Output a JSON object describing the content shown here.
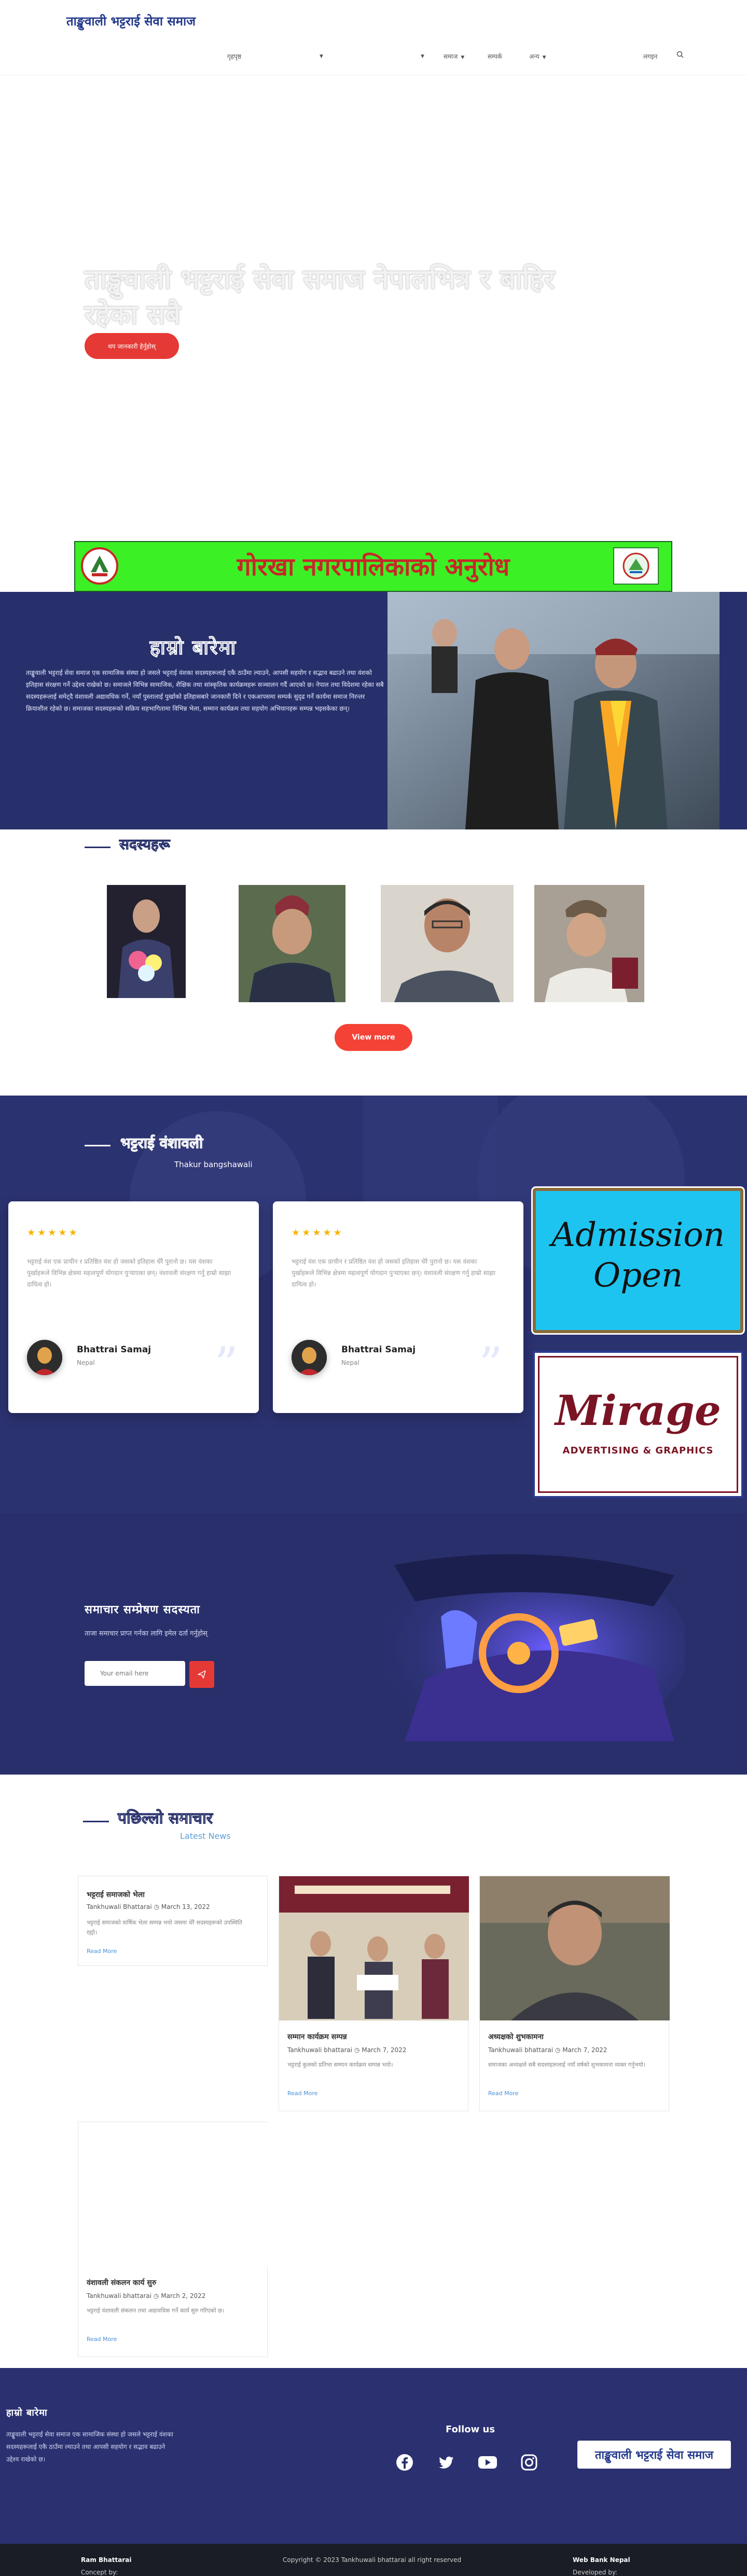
{
  "site": {
    "logo_text": "ताङ्खुवाली भट्टराई सेवा समाज"
  },
  "nav": {
    "items": [
      {
        "label": "गृहपृष्ठ",
        "dropdown": false
      },
      {
        "label": "",
        "dropdown": true
      },
      {
        "label": "",
        "dropdown": true
      },
      {
        "label": "समाज",
        "dropdown": true
      },
      {
        "label": "सम्पर्क",
        "dropdown": false
      },
      {
        "label": "अन्य",
        "dropdown": true
      },
      {
        "label": "लगइन",
        "dropdown": false
      }
    ],
    "search_icon": "search-icon"
  },
  "hero": {
    "title": "ताङ्खुवाली भट्टराई सेवा समाज नेपालभित्र र बाहिर रहेका सबै",
    "button_label": "थप जानकारी हेर्नुहोस्"
  },
  "banner_ad": {
    "text": "गोरखा नगरपालिकाको अनुरोध",
    "background": "#3cf026",
    "text_color": "#c62828"
  },
  "about": {
    "title": "हाम्रो बारेमा",
    "body": "ताङ्खुवाली भट्टराई सेवा समाज एक सामाजिक संस्था हो जसले भट्टराई वंशका सदस्यहरूलाई एकै ठाउँमा ल्याउने, आपसी सहयोग र सद्भाव बढाउने तथा वंशको इतिहास संरक्षण गर्ने उद्देश्य राखेको छ। समाजले विभिन्न सामाजिक, शैक्षिक तथा सांस्कृतिक कार्यक्रमहरू सञ्चालन गर्दै आएको छ। नेपाल तथा विदेशमा रहेका सबै सदस्यहरूलाई समेट्दै वंशावली अद्यावधिक गर्ने, नयाँ पुस्तालाई पुर्खाको इतिहासबारे जानकारी दिने र एकआपसमा सम्पर्क सुदृढ गर्ने कार्यमा समाज निरन्तर क्रियाशील रहेको छ। समाजका सदस्यहरूको सक्रिय सहभागितामा विभिन्न भेला, सम्मान कार्यक्रम तथा सहयोग अभियानहरू सम्पन्न भइसकेका छन्।"
  },
  "members": {
    "heading": "सदस्यहरू",
    "photos": [
      "member-photo-1",
      "member-photo-2",
      "member-photo-3",
      "member-photo-4"
    ],
    "more_button": "View more"
  },
  "testimonials": {
    "heading": "भट्टराई वंशावली",
    "subheading": "Thakur bangshawali",
    "cards": [
      {
        "stars": "★★★★★",
        "text": "भट्टराई वंश एक प्राचीन र प्रतिष्ठित वंश हो जसको इतिहास धेरै पुरानो छ। यस वंशका पुर्खाहरूले विभिन्न क्षेत्रमा महत्वपूर्ण योगदान पुर्‍याएका छन्। वंशावली संरक्षण गर्नु हाम्रो साझा दायित्व हो।",
        "name": "Bhattrai Samaj",
        "location": "Nepal"
      },
      {
        "stars": "★★★★★",
        "text": "भट्टराई वंश एक प्राचीन र प्रतिष्ठित वंश हो जसको इतिहास धेरै पुरानो छ। यस वंशका पुर्खाहरूले विभिन्न क्षेत्रमा महत्वपूर्ण योगदान पुर्‍याएका छन्। वंशावली संरक्षण गर्नु हाम्रो साझा दायित्व हो।",
        "name": "Bhattrai Samaj",
        "location": "Nepal"
      }
    ]
  },
  "side_ads": {
    "admission_line1": "Admission",
    "admission_line2": "Open",
    "mirage_title": "Mirage",
    "mirage_sub": "ADVERTISING & GRAPHICS"
  },
  "newsletter": {
    "title": "समाचार सम्प्रेषण सदस्यता",
    "subtitle": "ताजा समाचार प्राप्त गर्नका लागि इमेल दर्ता गर्नुहोस्",
    "input_placeholder": "Your email here",
    "send_icon": "send-icon"
  },
  "latest": {
    "title": "पछिल्लो समाचार",
    "subtitle": "Latest News",
    "read_more": "Read More",
    "cards": [
      {
        "title": "भट्टराई समाजको भेला",
        "author": "Tankhuwali Bhattarai",
        "date": "March 13, 2022",
        "excerpt": "भट्टराई समाजको वार्षिक भेला सम्पन्न भयो जसमा धेरै सदस्यहरूको उपस्थिति रह्यो।"
      },
      {
        "title": "सम्मान कार्यक्रम सम्पन्न",
        "author": "Tankhuwali bhattarai",
        "date": "March 7, 2022",
        "excerpt": "भट्टराई कुलको प्रतिभा सम्मान कार्यक्रम सम्पन्न भयो।"
      },
      {
        "title": "अध्यक्षको शुभकामना",
        "author": "Tankhuwali bhattarai",
        "date": "March 7, 2022",
        "excerpt": "समाजका अध्यक्षले सबै सदस्यहरूलाई नयाँ वर्षको शुभकामना व्यक्त गर्नुभयो।"
      },
      {
        "title": "वंशावली संकलन कार्य सुरु",
        "author": "Tankhuwali bhattarai",
        "date": "March 2, 2022",
        "excerpt": "भट्टराई वंशावली संकलन तथा अद्यावधिक गर्ने कार्य सुरु गरिएको छ।"
      }
    ]
  },
  "footer": {
    "title": "हाम्रो बारेमा",
    "text": "ताङ्खुवाली भट्टराई सेवा समाज एक सामाजिक संस्था हो जसले भट्टराई वंशका सदस्यहरूलाई एकै ठाउँमा ल्याउने तथा आपसी सहयोग र सद्भाव बढाउने उद्देश्य राखेको छ।",
    "follow_label": "Follow us",
    "socials": [
      "facebook-icon",
      "twitter-icon",
      "youtube-icon",
      "instagram-icon"
    ],
    "logo_text": "ताङ्खुवाली भट्टराई सेवा समाज"
  },
  "bottom_bar": {
    "concept_label": "Concept by:",
    "concept_name": "Ram Bhattarai",
    "copyright": "Copyright © 2023 Tankhuwali bhattarai all right reserved",
    "developed_label": "Developed by:",
    "developed_name": "Web Bank Nepal"
  },
  "colors": {
    "primary": "#27306b",
    "accent": "#e53935",
    "star": "#f5b400"
  }
}
